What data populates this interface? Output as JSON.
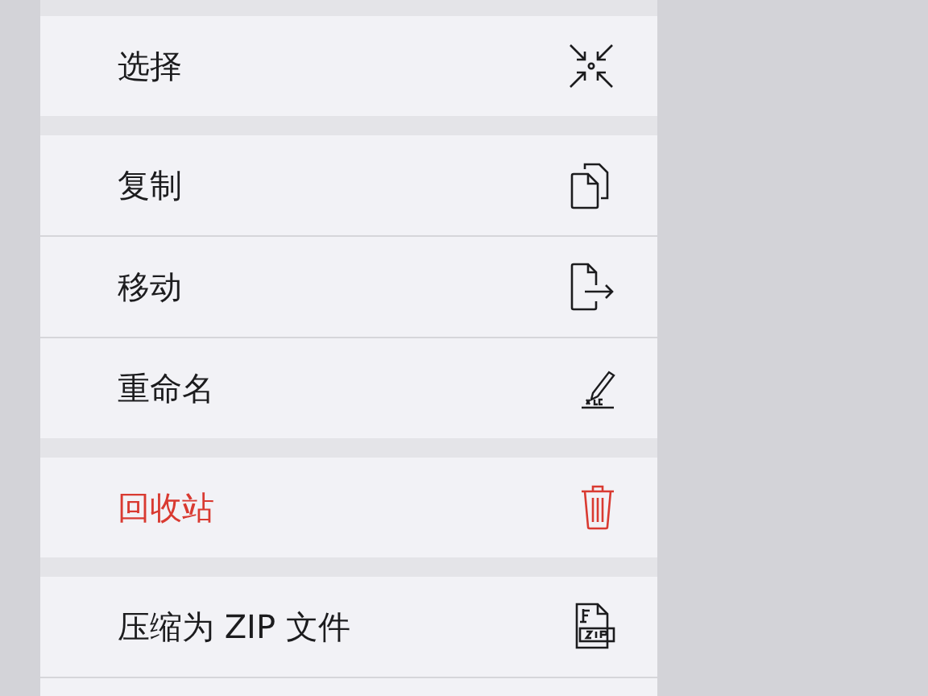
{
  "menu": {
    "groups": [
      {
        "items": [
          {
            "label": "选择",
            "kind": "collapse",
            "destructive": false
          }
        ]
      },
      {
        "items": [
          {
            "label": "复制",
            "kind": "copy",
            "destructive": false
          },
          {
            "label": "移动",
            "kind": "move",
            "destructive": false
          },
          {
            "label": "重命名",
            "kind": "rename",
            "destructive": false
          }
        ]
      },
      {
        "items": [
          {
            "label": "回收站",
            "kind": "trash",
            "destructive": true
          }
        ]
      },
      {
        "items": [
          {
            "label": "压缩为 ZIP 文件",
            "kind": "zip",
            "destructive": false
          }
        ]
      }
    ]
  }
}
